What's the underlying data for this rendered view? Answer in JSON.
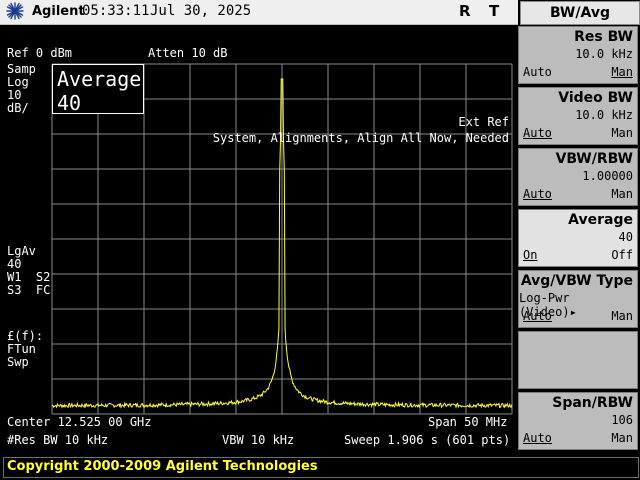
{
  "header": {
    "brand": "Agilent",
    "time": "05:33:11",
    "date": "Jul 30, 2025",
    "flag_r": "R",
    "flag_t": "T"
  },
  "screen": {
    "ref": "Ref 0 dBm",
    "atten": "Atten 10 dB",
    "left_labels_top": "Samp\nLog\n10\ndB/",
    "average_label": "Average",
    "average_value": "40",
    "ext_ref": "Ext Ref",
    "alignment_msg": "System, Alignments, Align All Now, Needed",
    "left_labels_mid": "LgAv\n40\nW1  S2\nS3  FC",
    "left_labels_low": "£(f):\nFTun\nSwp",
    "center": "Center 12.525 00 GHz",
    "span": "Span 50 MHz",
    "res_bw": "#Res BW 10 kHz",
    "vbw": "VBW 10 kHz",
    "sweep": "Sweep 1.906 s (601 pts)",
    "trace_color": "#ffff33"
  },
  "softkeys": {
    "menu_title": "BW/Avg",
    "keys": [
      {
        "name": "Res BW",
        "value": "10.0 kHz",
        "left": "Auto",
        "right": "Man"
      },
      {
        "name": "Video BW",
        "value": "10.0 kHz",
        "left": "Auto",
        "right": "Man"
      },
      {
        "name": "VBW/RBW",
        "value": "1.00000",
        "left": "Auto",
        "right": "Man"
      },
      {
        "name": "Average",
        "value": "40",
        "left": "On",
        "right": "Off"
      },
      {
        "name": "Avg/VBW Type",
        "value": "Log-Pwr (Video)▸",
        "left": "Auto",
        "right": "Man"
      },
      {
        "name": "",
        "value": "",
        "left": "",
        "right": ""
      },
      {
        "name": "Span/RBW",
        "value": "106",
        "left": "Auto",
        "right": "Man"
      }
    ]
  },
  "footer": {
    "copyright": "Copyright 2000-2009 Agilent Technologies"
  }
}
